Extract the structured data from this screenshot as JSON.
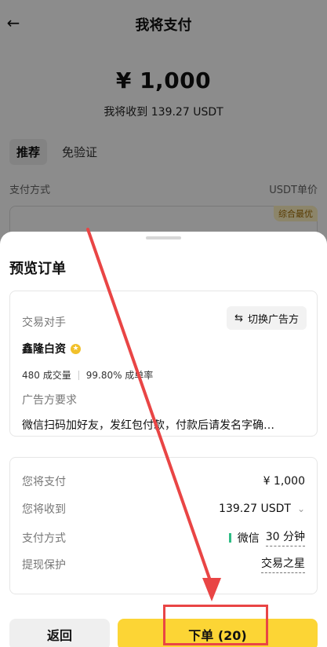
{
  "page": {
    "title": "我将支付",
    "back_icon": "←",
    "amount": "¥ 1,000",
    "receive_text": "我将收到 139.27 USDT",
    "tabs": [
      {
        "label": "推荐"
      },
      {
        "label": "免验证"
      }
    ],
    "col_pay_method": "支付方式",
    "col_unit_price": "USDT单价",
    "bg_badge": "综合最优"
  },
  "sheet": {
    "title": "预览订单",
    "counterparty_label": "交易对手",
    "switch_label": "切换广告方",
    "switch_icon": "⇆",
    "merchant_name": "鑫隆白资",
    "verify_icon": "★",
    "stats_trades": "480 成交量",
    "stats_rate": "99.80% 成单率",
    "req_label": "广告方要求",
    "req_text": "微信扫码加好友，发红包付款，付款后请发名字确…",
    "summary": {
      "pay_label": "您将支付",
      "pay_value": "¥ 1,000",
      "receive_label": "您将收到",
      "receive_value": "139.27 USDT",
      "chevron": "⌄",
      "method_label": "支付方式",
      "method_value": "微信",
      "method_time": "30 分钟",
      "protect_label": "提现保护",
      "protect_value": "交易之星"
    },
    "btn_back": "返回",
    "btn_order": "下单 (20)"
  },
  "colors": {
    "accent": "#fcd535",
    "annotation": "#e94545",
    "wechat_green": "#2ebd85"
  }
}
